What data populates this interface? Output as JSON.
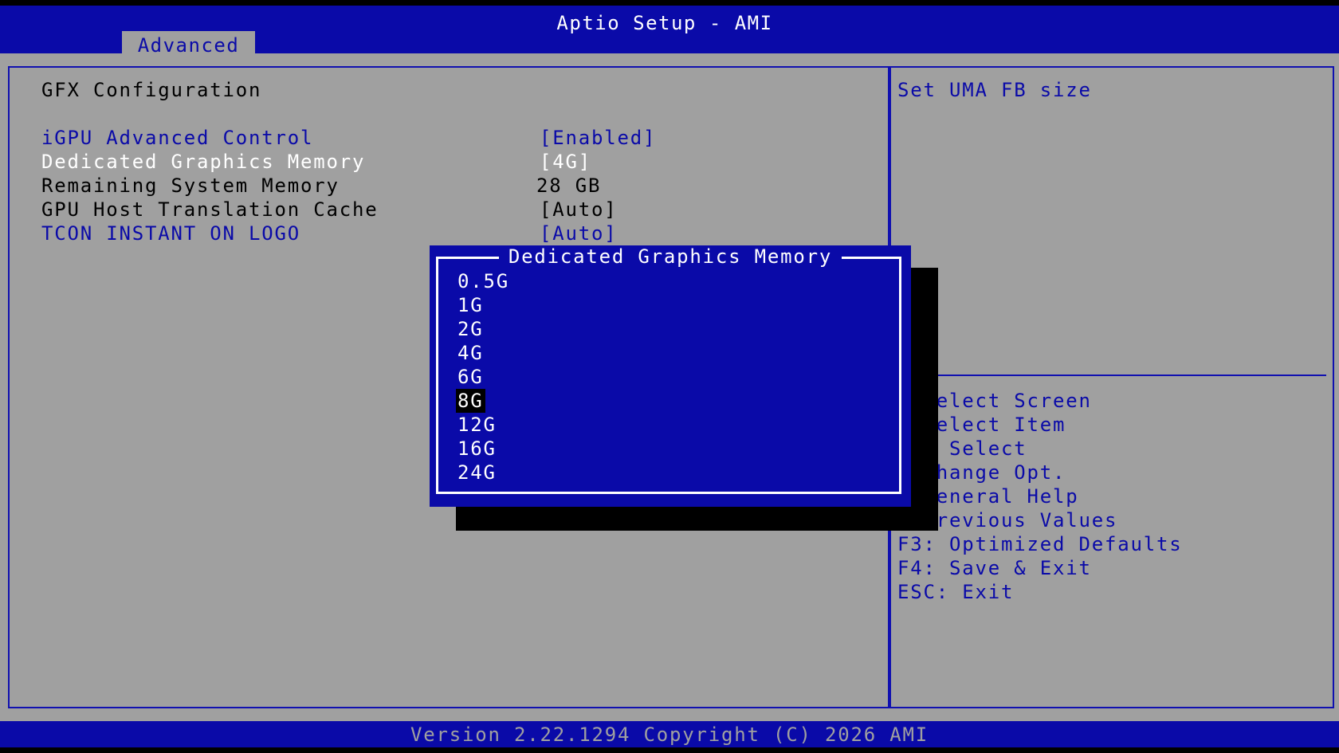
{
  "app_title": "Aptio Setup - AMI",
  "tabs": [
    {
      "label": "Advanced"
    }
  ],
  "page": {
    "title": "GFX Configuration",
    "items": [
      {
        "label": "iGPU Advanced Control",
        "value": "[Enabled]"
      },
      {
        "label": "Dedicated Graphics Memory",
        "value": "[4G]"
      },
      {
        "label": "Remaining System Memory",
        "value": "28 GB"
      },
      {
        "label": "GPU Host Translation Cache",
        "value": "[Auto]"
      },
      {
        "label": "TCON INSTANT ON LOGO",
        "value": "[Auto]"
      }
    ]
  },
  "help": {
    "text": "Set UMA FB size"
  },
  "keys": [
    "  Select Screen",
    "  Select Item",
    "er: Select",
    ": Change Opt.",
    "  General Help",
    "  Previous Values",
    "F3: Optimized Defaults",
    "F4: Save & Exit",
    "ESC: Exit"
  ],
  "popup": {
    "title": "Dedicated Graphics Memory",
    "options": [
      "0.5G",
      "1G",
      "2G",
      "4G",
      "6G",
      "8G",
      "12G",
      "16G",
      "24G"
    ],
    "selected": "8G"
  },
  "footer": "Version 2.22.1294 Copyright (C) 2026 AMI",
  "colors": {
    "blue": "#0a0aa8",
    "gray": "#a0a0a0",
    "black": "#000000",
    "white": "#ffffff"
  }
}
